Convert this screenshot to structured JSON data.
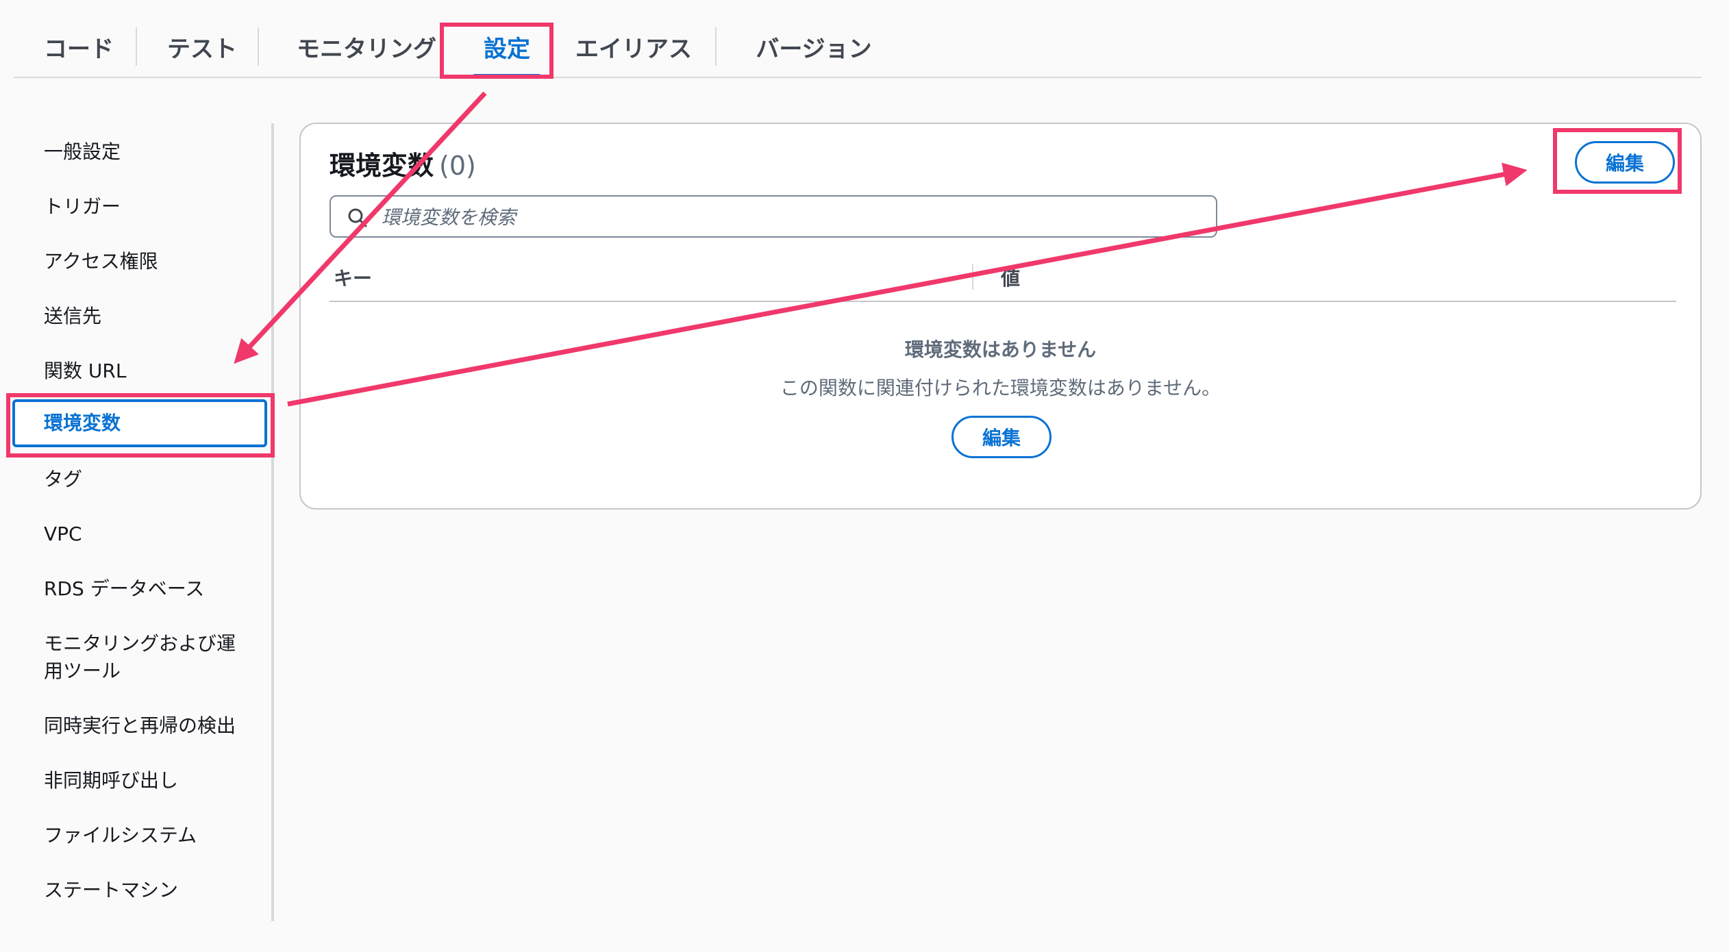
{
  "tabs": [
    {
      "label": "コード"
    },
    {
      "label": "テスト"
    },
    {
      "label": "モニタリング"
    },
    {
      "label": "設定",
      "active": true
    },
    {
      "label": "エイリアス"
    },
    {
      "label": "バージョン"
    }
  ],
  "sidebar": {
    "items": [
      {
        "label": "一般設定"
      },
      {
        "label": "トリガー"
      },
      {
        "label": "アクセス権限"
      },
      {
        "label": "送信先"
      },
      {
        "label": "関数 URL"
      },
      {
        "label": "環境変数",
        "active": true
      },
      {
        "label": "タグ"
      },
      {
        "label": "VPC"
      },
      {
        "label": "RDS データベース"
      },
      {
        "label": "モニタリングおよび運用ツール"
      },
      {
        "label": "同時実行と再帰の検出"
      },
      {
        "label": "非同期呼び出し"
      },
      {
        "label": "ファイルシステム"
      },
      {
        "label": "ステートマシン"
      }
    ]
  },
  "panel": {
    "title": "環境変数",
    "count": "(0)",
    "edit_label": "編集",
    "search_placeholder": "環境変数を検索",
    "columns": {
      "key": "キー",
      "value": "値"
    },
    "empty": {
      "title": "環境変数はありません",
      "description": "この関数に関連付けられた環境変数はありません。",
      "edit_label": "編集"
    }
  },
  "colors": {
    "accent": "#0972d3",
    "highlight": "#f0386b",
    "text": "#16191f",
    "muted": "#5f6b7a"
  }
}
